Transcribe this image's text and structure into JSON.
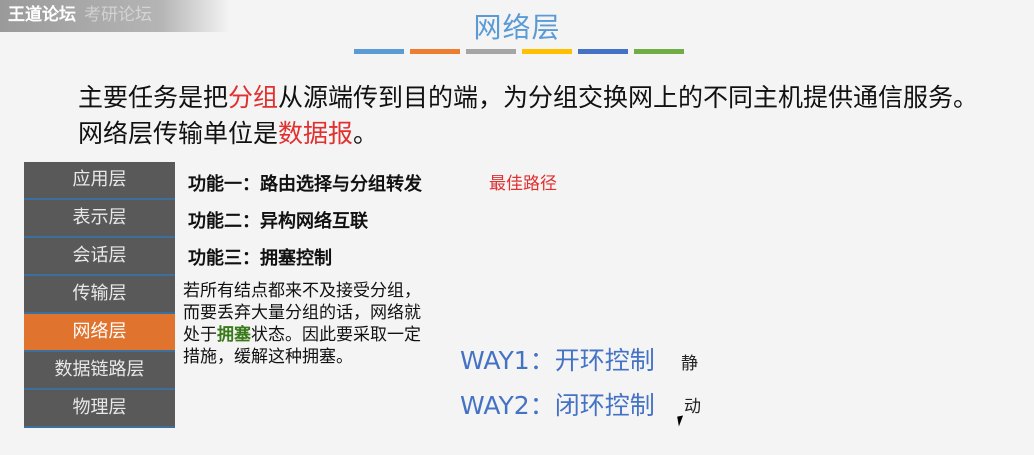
{
  "watermark": {
    "main": "王道论坛",
    "sub": "考研论坛"
  },
  "slide": {
    "title": "网络层",
    "title_bar_colors": [
      "#5b9bd5",
      "#ed7d31",
      "#a5a5a5",
      "#ffc000",
      "#4472c4",
      "#70ad47"
    ],
    "main_line1_a": "主要任务是把",
    "main_line1_highlight": "分组",
    "main_line1_b": "从源端传到目的端，为分组交换网上的不同主机提供通信服务。",
    "main_line2_a": "网络层传输单位是",
    "main_line2_highlight": "数据报",
    "main_line2_b": "。"
  },
  "layers": [
    "应用层",
    "表示层",
    "会话层",
    "传输层",
    "网络层",
    "数据链路层",
    "物理层"
  ],
  "active_layer": "网络层",
  "functions": {
    "f1": "功能一：路由选择与分组转发",
    "f1_note": "最佳路径",
    "f2": "功能二：异构网络互联",
    "f3": "功能三：拥塞控制"
  },
  "description": {
    "a": "若所有结点都来不及接受分组，而要丢弃大量分组的话，网络就处于",
    "highlight": "拥塞",
    "b": "状态。因此要采取一定措施，缓解这种拥塞。"
  },
  "ways": {
    "way1": "WAY1：开环控制",
    "way1_note": "静",
    "way2": "WAY2：闭环控制",
    "way2_note": "动"
  },
  "colors": {
    "accent_blue": "#5b9bd5",
    "highlight_red": "#e03030",
    "active_layer": "#e0742f",
    "layer_bg": "#595959"
  }
}
